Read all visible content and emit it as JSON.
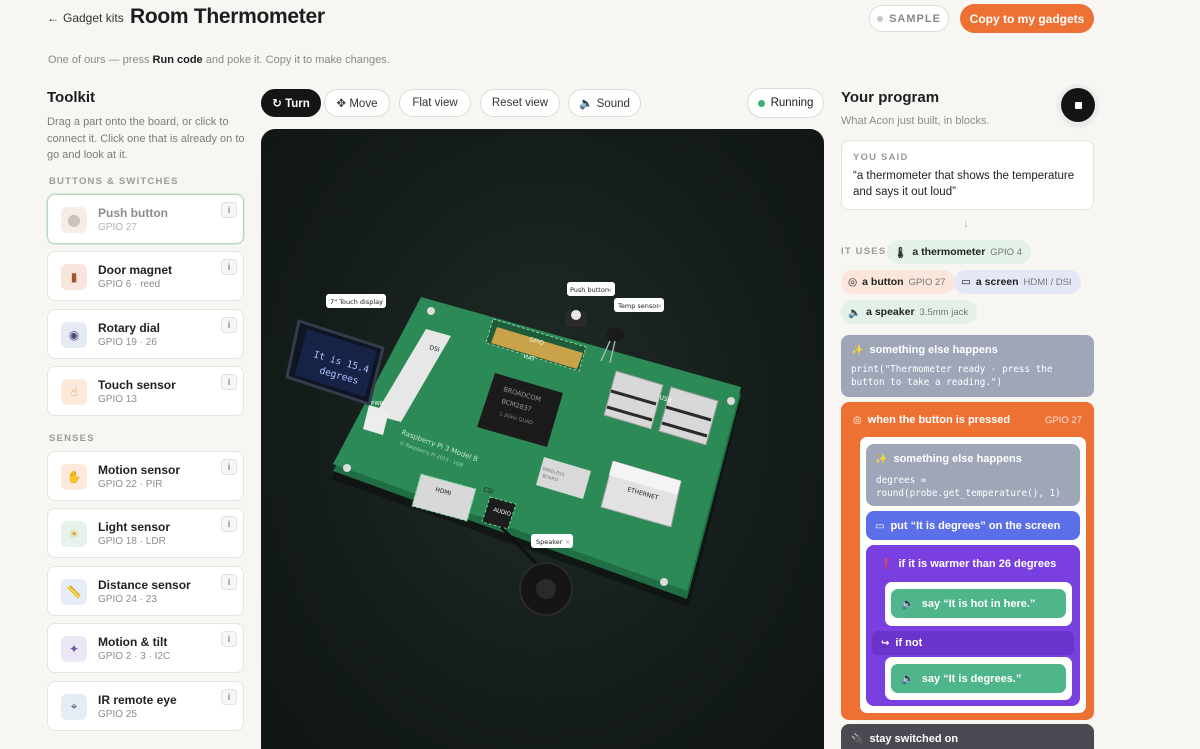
{
  "header": {
    "back_label": "Gadget kits",
    "back_icon": "arrow-left-icon",
    "title": "Room Thermometer",
    "sample_label": "SAMPLE",
    "copy_button": "Copy to my gadgets",
    "subtitle_pre": "One of ours — press ",
    "subtitle_bold": "Run code",
    "subtitle_post": " and poke it. Copy it to make changes.",
    "accent_color": "#ee7134"
  },
  "toolkit": {
    "title": "Toolkit",
    "hint": "Drag a part onto the board, or click to connect it. Click one that is already on to go and look at it.",
    "sections": [
      {
        "label": "BUTTONS & SWITCHES",
        "items": [
          {
            "name": "Push button",
            "pin": "GPIO 27",
            "icon": "push-button-icon",
            "glyph": "⬤",
            "bg": "#f7ece6",
            "fg": "#c9c2bd",
            "active": true
          },
          {
            "name": "Door magnet",
            "pin": "GPIO 6 · reed",
            "icon": "door-icon",
            "glyph": "▮",
            "bg": "#f8e6dd",
            "fg": "#a4532f",
            "active": false
          },
          {
            "name": "Rotary dial",
            "pin": "GPIO 19 · 26",
            "icon": "dial-icon",
            "glyph": "◉",
            "bg": "#e6e9f6",
            "fg": "#4a4f7a",
            "active": false
          },
          {
            "name": "Touch sensor",
            "pin": "GPIO 13",
            "icon": "touch-icon",
            "glyph": "☝",
            "bg": "#fbe9dc",
            "fg": "#d9832f",
            "active": false
          }
        ]
      },
      {
        "label": "SENSES",
        "items": [
          {
            "name": "Motion sensor",
            "pin": "GPIO 22 · PIR",
            "icon": "wave-hand-icon",
            "glyph": "✋",
            "bg": "#fbeadc",
            "fg": "#e0912f",
            "active": false
          },
          {
            "name": "Light sensor",
            "pin": "GPIO 18 · LDR",
            "icon": "sun-icon",
            "glyph": "☀",
            "bg": "#e7f3ea",
            "fg": "#e0a72f",
            "active": false
          },
          {
            "name": "Distance sensor",
            "pin": "GPIO 24 · 23",
            "icon": "ruler-icon",
            "glyph": "📏",
            "bg": "#e6ecf7",
            "fg": "#5570a8",
            "active": false
          },
          {
            "name": "Motion & tilt",
            "pin": "GPIO 2 · 3 · I2C",
            "icon": "compass-icon",
            "glyph": "✦",
            "bg": "#ece7f6",
            "fg": "#6b55a8",
            "active": false
          },
          {
            "name": "IR remote eye",
            "pin": "GPIO 25",
            "icon": "satellite-icon",
            "glyph": "⌖",
            "bg": "#e6ecf4",
            "fg": "#3f5470",
            "active": false
          }
        ]
      }
    ]
  },
  "toolbar": {
    "turn": "↻ Turn",
    "move": "✥ Move",
    "flat": "Flat view",
    "reset": "Reset view",
    "sound": "🔈 Sound",
    "running": "Running"
  },
  "board": {
    "screen_text_1": "It is 15.4",
    "screen_text_2": "degrees",
    "labels": {
      "touch_display": "7\" Touch display",
      "push_button": "Push button",
      "temp_sensor": "Temp sensor",
      "speaker": "Speaker"
    },
    "silk": {
      "dsi": "DSI",
      "gpio": "GPIO",
      "hat": "HAT",
      "pwr": "PWR",
      "usb": "USB",
      "ethernet": "ETHERNET",
      "hdmi": "HDMI",
      "csi": "CSI",
      "audio": "AUDIO",
      "chip_1": "BROADCOM",
      "chip_2": "BCM2837",
      "chip_3": "1.2GHz QUAD",
      "model": "Raspberry Pi 3 Model B",
      "model_sub": "© Raspberry Pi 2015 · 1GB",
      "wireless": "WIRELESS",
      "wireless_2": "BOARD"
    },
    "close_glyph": "×"
  },
  "program": {
    "title": "Your program",
    "subtitle": "What Acon just built, in blocks.",
    "said_label": "YOU SAID",
    "said_text": "“a thermometer that shows the temperature and says it out loud”",
    "arrow": "↓",
    "uses_label": "IT USES",
    "uses": [
      {
        "name": "a thermometer",
        "detail": "GPIO 4",
        "icon": "thermometer-icon",
        "glyph": "🌡",
        "bg": "#e3f1e6"
      },
      {
        "name": "a button",
        "detail": "GPIO 27",
        "icon": "button-icon",
        "glyph": "◎",
        "bg": "#fbe6dc"
      },
      {
        "name": "a screen",
        "detail": "HDMI / DSI",
        "icon": "monitor-icon",
        "glyph": "▭",
        "bg": "#e4e7f5"
      },
      {
        "name": "a speaker",
        "detail": "3.5mm jack",
        "icon": "speaker-icon",
        "glyph": "🔈",
        "bg": "#e3f1e6"
      }
    ],
    "block_else_1": {
      "title": "something else happens",
      "code_1": "print(\"Thermometer ready - press the",
      "code_2": "button to take a reading.\")"
    },
    "block_when": {
      "title": "when the button is pressed",
      "pin": "GPIO 27"
    },
    "block_else_2": {
      "title": "something else happens",
      "code_1": "degrees =",
      "code_2": "round(probe.get_temperature(), 1)"
    },
    "block_put": "put “It is degrees” on the screen",
    "block_if": "if it is warmer than 26 degrees",
    "block_say_1": "say “It is hot in here.”",
    "block_ifnot": "if not",
    "block_say_2": "say “It is degrees.”",
    "block_stay": "stay switched on",
    "colors": {
      "grey_block": "#9ea6b8",
      "orange_block": "#ee7134",
      "blue_block": "#5b6fe8",
      "purple_block": "#7a3fe0",
      "green_say": "#4fb58a",
      "dark_block": "#4a4a52"
    }
  }
}
